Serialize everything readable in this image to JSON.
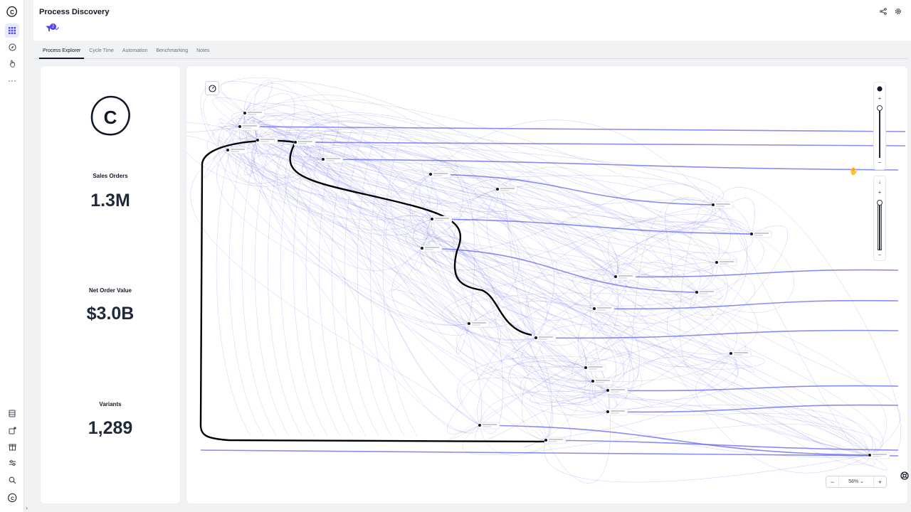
{
  "app": {
    "title": "Process Discovery",
    "accent_color": "#4f46e5",
    "filter_count": "2"
  },
  "rail": {
    "logo_icon": "celonis-logo-icon",
    "items": [
      "apps-grid-icon",
      "compass-icon",
      "hand-pointer-icon",
      "more-icon"
    ],
    "bottom_items": [
      "database-icon",
      "external-link-icon",
      "package-icon",
      "sliders-icon",
      "search-icon",
      "celonis-logo-icon"
    ],
    "expand_glyph": "›"
  },
  "header": {
    "share_icon": "share-icon",
    "settings_icon": "gear-icon"
  },
  "tabs": [
    {
      "label": "Process Explorer",
      "active": true
    },
    {
      "label": "Cycle Time",
      "active": false
    },
    {
      "label": "Automation",
      "active": false
    },
    {
      "label": "Benchmarking",
      "active": false
    },
    {
      "label": "Notes",
      "active": false
    }
  ],
  "kpis": {
    "logo_letter": "C",
    "sales_orders": {
      "label": "Sales Orders",
      "value": "1.3M"
    },
    "net_order_value": {
      "label": "Net Order Value",
      "value": "$3.0B"
    },
    "variants": {
      "label": "Variants",
      "value": "1,289"
    }
  },
  "explorer": {
    "zoom_level": "58%",
    "zoom_minus": "−",
    "zoom_plus": "+",
    "activities_slider": {
      "plus": "+",
      "minus": "−"
    },
    "connections_slider": {
      "plus": "+",
      "minus": "−",
      "arrow": "↓"
    },
    "edge_color": "#6366f1",
    "highlight_path_color": "#000000"
  }
}
